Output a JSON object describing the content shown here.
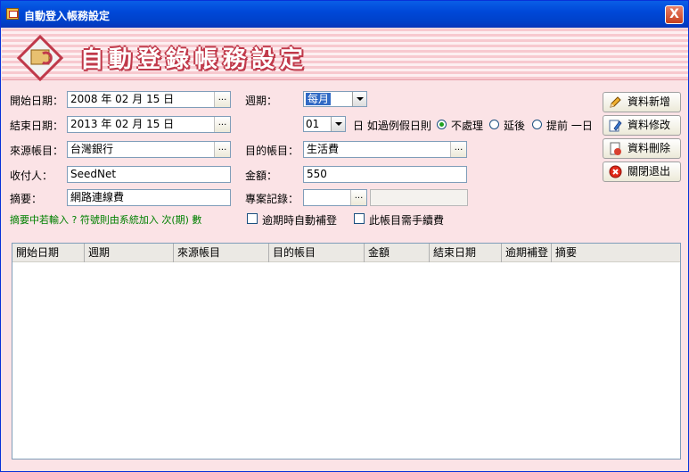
{
  "window": {
    "title": "自動登入帳務設定",
    "close_glyph": "X"
  },
  "banner": {
    "title": "自動登錄帳務設定"
  },
  "form": {
    "start_date": {
      "label": "開始日期：",
      "value": "2008 年 02 月 15 日"
    },
    "end_date": {
      "label": "結束日期：",
      "value": "2013 年 02 月 15 日"
    },
    "source_account": {
      "label": "來源帳目：",
      "value": "台灣銀行"
    },
    "payee": {
      "label": "收付人：",
      "value": "SeedNet"
    },
    "summary": {
      "label": "摘要：",
      "value": "網路連線費"
    },
    "period": {
      "label": "週期：",
      "value": "每月"
    },
    "day": {
      "value": "01",
      "suffix": "日 如過例假日則"
    },
    "holiday_options": [
      {
        "label": "不處理",
        "selected": true
      },
      {
        "label": "延後",
        "selected": false
      },
      {
        "label": "提前 一日",
        "selected": false
      }
    ],
    "target_account": {
      "label": "目的帳目：",
      "value": "生活費"
    },
    "amount": {
      "label": "金額：",
      "value": "550"
    },
    "project": {
      "label": "專案記錄：",
      "value": ""
    },
    "dots_label": "...",
    "note": "摘要中若輸入 ? 符號則由系統加入 次(期) 數",
    "auto_fill_label": "逾期時自動補登",
    "manual_fill_label": "此帳目需手續費"
  },
  "buttons": {
    "add": "資料新增",
    "edit": "資料修改",
    "delete": "資料刪除",
    "exit": "關閉退出"
  },
  "table": {
    "columns": [
      "開始日期",
      "週期",
      "來源帳目",
      "目的帳目",
      "金額",
      "結束日期",
      "逾期補登",
      "摘要"
    ],
    "rows": []
  },
  "colors": {
    "titlebar": "#0048d8",
    "background": "#fbe3e6",
    "banner_text_outline": "#c0394a",
    "note": "#008000"
  }
}
